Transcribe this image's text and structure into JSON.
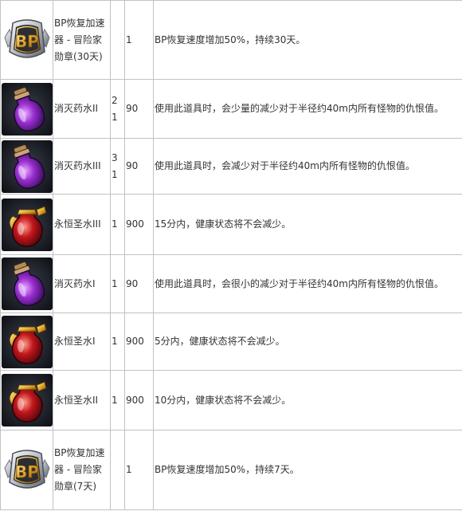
{
  "rows": [
    {
      "icon": "bp-medal-icon",
      "name": "BP恢复加速器 - 冒险家勋章(30天)",
      "qty": "",
      "amount": "1",
      "desc": "BP恢复速度增加50%，持续30天。"
    },
    {
      "icon": "purple-potion-icon",
      "name": "消灭药水II",
      "qty": "21",
      "amount": "90",
      "desc": "使用此道具时，会少量的减少对于半径约40m内所有怪物的仇恨值。"
    },
    {
      "icon": "purple-potion-icon",
      "name": "消灭药水III",
      "qty": "31",
      "amount": "90",
      "desc": "使用此道具时，会减少对于半径约40m内所有怪物的仇恨值。"
    },
    {
      "icon": "red-holy-water-icon",
      "name": "永恒圣水III",
      "qty": "1",
      "amount": "900",
      "desc": "15分内，健康状态将不会减少。"
    },
    {
      "icon": "purple-potion-icon",
      "name": "消灭药水I",
      "qty": "1",
      "amount": "90",
      "desc": "使用此道具时，会很小的减少对于半径约40m内所有怪物的仇恨值。"
    },
    {
      "icon": "red-holy-water-icon",
      "name": "永恒圣水I",
      "qty": "1",
      "amount": "900",
      "desc": "5分内，健康状态将不会减少。"
    },
    {
      "icon": "red-holy-water-icon",
      "name": "永恒圣水II",
      "qty": "1",
      "amount": "900",
      "desc": "10分内，健康状态将不会减少。"
    },
    {
      "icon": "bp-medal-icon",
      "name": "BP恢复加速器 - 冒险家勋章(7天)",
      "qty": "",
      "amount": "1",
      "desc": "BP恢复速度增加50%，持续7天。"
    }
  ],
  "bp_label": "BP",
  "colors": {
    "border": "#c2c2c2",
    "text": "#333333",
    "icon_bg": "#1a1d24"
  }
}
